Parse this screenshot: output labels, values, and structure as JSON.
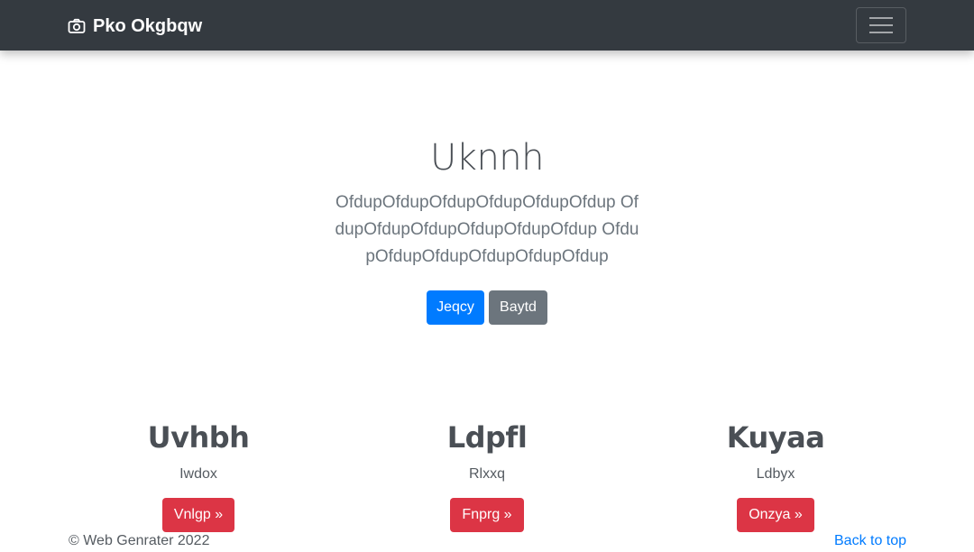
{
  "navbar": {
    "brand_icon": "camera-icon",
    "brand_text": "Pko Okgbqw",
    "toggler_icon": "hamburger-icon",
    "background": "#343a40"
  },
  "hero": {
    "title": "Uknnh",
    "lead": "OfdupOfdupOfdupOfdupOfdupOfdup OfdupOfdupOfdupOfdupOfdupOfdup OfdupOfdupOfdupOfdupOfdupOfdup",
    "primary_button": "Jeqcy",
    "secondary_button": "Baytd"
  },
  "columns": [
    {
      "title": "Uvhbh",
      "text": "Iwdox",
      "button": "Vnlgp »"
    },
    {
      "title": "Ldpfl",
      "text": "Rlxxq",
      "button": "Fnprg »"
    },
    {
      "title": "Kuyaa",
      "text": "Ldbyx",
      "button": "Onzya »"
    }
  ],
  "footer": {
    "copyright": "© Web Genrater 2022",
    "back_to_top": "Back to top"
  },
  "colors": {
    "primary": "#007bff",
    "secondary": "#6c757d",
    "danger": "#dc3545"
  }
}
